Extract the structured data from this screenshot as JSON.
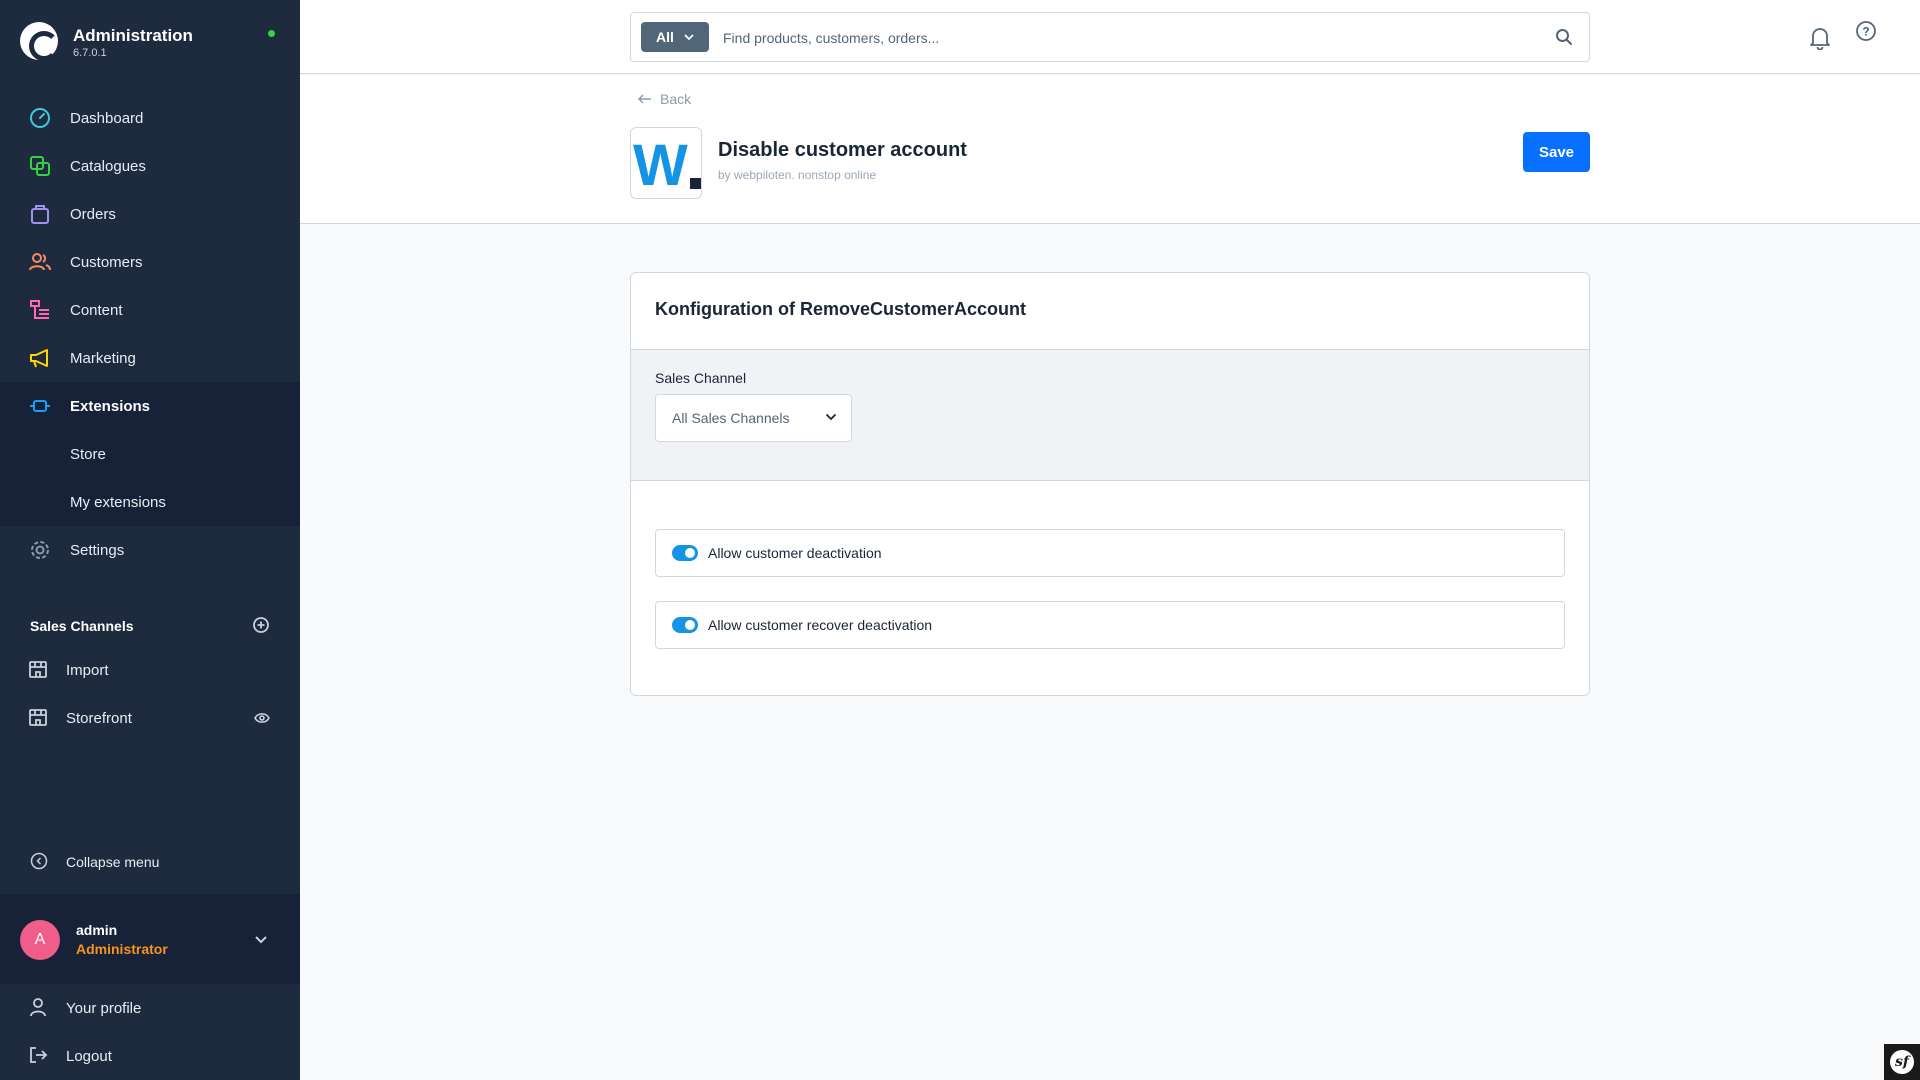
{
  "brand": {
    "title": "Administration",
    "version": "6.7.0.1"
  },
  "nav": {
    "dashboard": "Dashboard",
    "catalogues": "Catalogues",
    "orders": "Orders",
    "customers": "Customers",
    "content": "Content",
    "marketing": "Marketing",
    "extensions": "Extensions",
    "store": "Store",
    "my_extensions": "My extensions",
    "settings": "Settings"
  },
  "sales_channels": {
    "heading": "Sales Channels",
    "items": [
      "Import",
      "Storefront"
    ]
  },
  "collapse_menu": "Collapse menu",
  "user": {
    "initial": "A",
    "name": "admin",
    "role": "Administrator",
    "menu": [
      "Your profile",
      "Logout"
    ]
  },
  "search": {
    "type": "All",
    "placeholder": "Find products, customers, orders..."
  },
  "header": {
    "back": "Back",
    "plugin_title": "Disable customer account",
    "plugin_author": "by webpiloten. nonstop online",
    "save": "Save",
    "logo_letter": "W"
  },
  "config": {
    "title": "Konfiguration of RemoveCustomerAccount",
    "channel_label": "Sales Channel",
    "channel_value": "All Sales Channels",
    "toggles": [
      {
        "label": "Allow customer deactivation",
        "on": true
      },
      {
        "label": "Allow customer recover deactivation",
        "on": true
      }
    ]
  },
  "colors": {
    "sidebar": "#1e2a3e",
    "primary": "#0870ff",
    "toggle": "#1594e6",
    "role": "#f7941d",
    "status": "#37d046"
  }
}
